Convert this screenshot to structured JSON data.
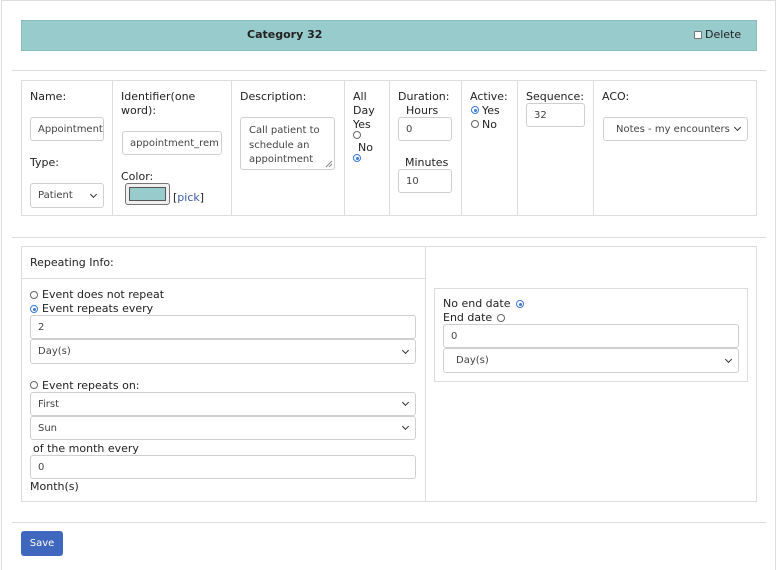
{
  "header": {
    "title": "Category 32",
    "delete_label": "Delete"
  },
  "fields": {
    "name": {
      "label": "Name:",
      "value": "Appointment"
    },
    "type": {
      "label": "Type:",
      "value": "Patient"
    },
    "identifier": {
      "label_1": "Identifier(one",
      "label_2": "word):",
      "value": "appointment_rem"
    },
    "color": {
      "label": "Color:",
      "swatch": "#98cbcb",
      "bracket_open": "[",
      "pick_label": "pick",
      "bracket_close": "]"
    },
    "description": {
      "label": "Description:",
      "lines": [
        "Call patient to",
        "schedule an",
        "appointment"
      ]
    },
    "all_day": {
      "label_1": "All",
      "label_2": "Day",
      "yes_label": "Yes",
      "no_label": "No",
      "selected": "No"
    },
    "duration": {
      "label": "Duration:",
      "hours_label": "Hours",
      "hours_value": "0",
      "minutes_label": "Minutes",
      "minutes_value": "10"
    },
    "active": {
      "label": "Active:",
      "yes_label": "Yes",
      "no_label": "No",
      "selected": "Yes"
    },
    "sequence": {
      "label": "Sequence:",
      "value": "32"
    },
    "aco": {
      "label": "ACO:",
      "value": "Notes - my encounters (write)"
    }
  },
  "repeating": {
    "title": "Repeating Info:",
    "no_repeat_label": "Event does not repeat",
    "repeats_every_label": "Event repeats every",
    "every_value": "2",
    "every_unit": "Day(s)",
    "repeats_on_label": "Event repeats on:",
    "on_ordinal": "First",
    "on_day": "Sun",
    "month_every_label": "of the month every",
    "month_value": "0",
    "month_unit_label": "Month(s)",
    "selected": "repeats_every"
  },
  "end": {
    "no_end_label": "No end date",
    "end_date_label": "End date",
    "end_value": "0",
    "end_unit": "Day(s)",
    "selected": "no_end"
  },
  "footer": {
    "save_label": "Save"
  },
  "colors": {
    "accent": "#98cbcb",
    "button": "#3f67be",
    "radio": "#3b7bd6"
  }
}
